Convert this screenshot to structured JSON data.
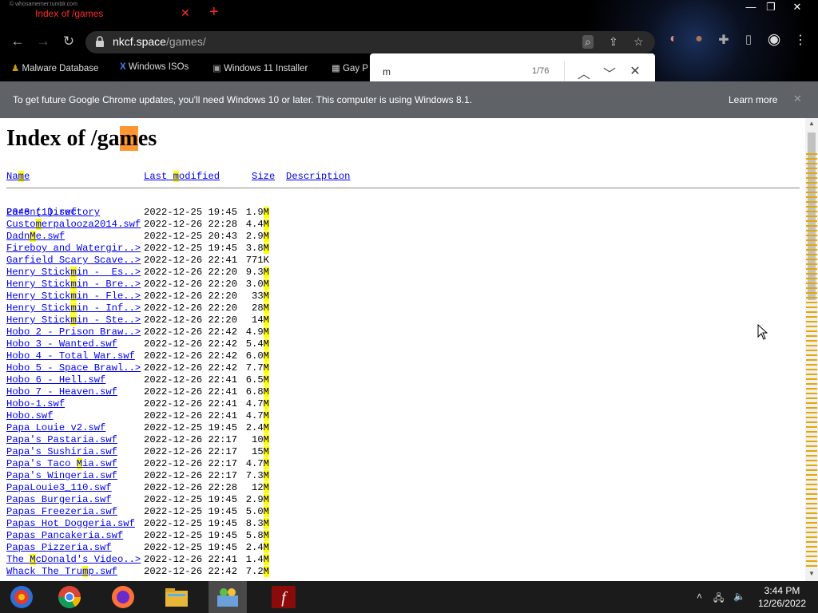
{
  "tab": {
    "title": "Index of /games",
    "tiny_label": "© whosamemer.tumblr.com"
  },
  "window": {
    "minimize": "—",
    "restore": "❐",
    "close": "✕"
  },
  "omnibox": {
    "host": "nkcf.space",
    "path": "/games/"
  },
  "bookmarks": [
    {
      "label": "Malware Database",
      "icon": "bookmark-icon"
    },
    {
      "label": "Windows ISOs",
      "icon": "x-logo-icon"
    },
    {
      "label": "Windows 11 Installer",
      "icon": "image-icon"
    },
    {
      "label": "Gay P",
      "icon": "pixel-icon"
    }
  ],
  "find": {
    "query": "m",
    "count": "1/76"
  },
  "infobar": {
    "message": "To get future Google Chrome updates, you'll need Windows 10 or later. This computer is using Windows 8.1.",
    "learn_more": "Learn more"
  },
  "page": {
    "heading_pre": "Index of /ga",
    "heading_match": "m",
    "heading_post": "es",
    "columns": {
      "name_pre": "Na",
      "name_m": "m",
      "name_post": "e",
      "modified_pre": "Last ",
      "modified_m": "m",
      "modified_post": "odified",
      "size": "Size",
      "description": "Description"
    },
    "parent": {
      "name": "Parent Directory",
      "size": "-"
    },
    "files": [
      {
        "name": "2048 (1).swf",
        "date": "2022-12-25 19:45",
        "size": "1.9M"
      },
      {
        "name": "Customerpalooza2014.swf",
        "date": "2022-12-26 22:28",
        "size": "4.4M"
      },
      {
        "name": "DadnMe.swf",
        "date": "2022-12-25 20:43",
        "size": "2.9M"
      },
      {
        "name": "Fireboy and Watergir..>",
        "date": "2022-12-25 19:45",
        "size": "3.8M"
      },
      {
        "name": "Garfield Scary Scave..>",
        "date": "2022-12-26 22:41",
        "size": "771K"
      },
      {
        "name": "Henry Stickmin -  Es..>",
        "date": "2022-12-26 22:20",
        "size": "9.3M"
      },
      {
        "name": "Henry Stickmin - Bre..>",
        "date": "2022-12-26 22:20",
        "size": "3.0M"
      },
      {
        "name": "Henry Stickmin - Fle..>",
        "date": "2022-12-26 22:20",
        "size": "33M"
      },
      {
        "name": "Henry Stickmin - Inf..>",
        "date": "2022-12-26 22:20",
        "size": "28M"
      },
      {
        "name": "Henry Stickmin - Ste..>",
        "date": "2022-12-26 22:20",
        "size": "14M"
      },
      {
        "name": "Hobo 2 - Prison Braw..>",
        "date": "2022-12-26 22:42",
        "size": "4.9M"
      },
      {
        "name": "Hobo 3 - Wanted.swf",
        "date": "2022-12-26 22:42",
        "size": "5.4M"
      },
      {
        "name": "Hobo 4 - Total War.swf",
        "date": "2022-12-26 22:42",
        "size": "6.0M"
      },
      {
        "name": "Hobo 5 - Space Brawl..>",
        "date": "2022-12-26 22:42",
        "size": "7.7M"
      },
      {
        "name": "Hobo 6 - Hell.swf",
        "date": "2022-12-26 22:41",
        "size": "6.5M"
      },
      {
        "name": "Hobo 7 - Heaven.swf",
        "date": "2022-12-26 22:41",
        "size": "6.8M"
      },
      {
        "name": "Hobo-1.swf",
        "date": "2022-12-26 22:41",
        "size": "4.7M"
      },
      {
        "name": "Hobo.swf",
        "date": "2022-12-26 22:41",
        "size": "4.7M"
      },
      {
        "name": "Papa Louie v2.swf",
        "date": "2022-12-25 19:45",
        "size": "2.4M"
      },
      {
        "name": "Papa's Pastaria.swf",
        "date": "2022-12-26 22:17",
        "size": "10M"
      },
      {
        "name": "Papa's Sushiria.swf",
        "date": "2022-12-26 22:17",
        "size": "15M"
      },
      {
        "name": "Papa's Taco Mia.swf",
        "date": "2022-12-26 22:17",
        "size": "4.7M"
      },
      {
        "name": "Papa's Wingeria.swf",
        "date": "2022-12-26 22:17",
        "size": "7.3M"
      },
      {
        "name": "PapaLouie3_110.swf",
        "date": "2022-12-26 22:28",
        "size": "12M"
      },
      {
        "name": "Papas Burgeria.swf",
        "date": "2022-12-25 19:45",
        "size": "2.9M"
      },
      {
        "name": "Papas Freezeria.swf",
        "date": "2022-12-25 19:45",
        "size": "5.0M"
      },
      {
        "name": "Papas Hot Doggeria.swf",
        "date": "2022-12-25 19:45",
        "size": "8.3M"
      },
      {
        "name": "Papas Pancakeria.swf",
        "date": "2022-12-25 19:45",
        "size": "5.8M"
      },
      {
        "name": "Papas Pizzeria.swf",
        "date": "2022-12-25 19:45",
        "size": "2.4M"
      },
      {
        "name": "The McDonald's Video..>",
        "date": "2022-12-26 22:41",
        "size": "1.4M"
      },
      {
        "name": "Whack The Trump.swf",
        "date": "2022-12-26 22:42",
        "size": "7.2M"
      }
    ]
  },
  "taskbar": {
    "apps": [
      "start-icon",
      "chrome-icon",
      "firefox-icon",
      "file-explorer-icon",
      "control-panel-icon",
      "flash-player-icon"
    ]
  },
  "clock": {
    "time": "3:44 PM",
    "date": "12/26/2022"
  },
  "colors": {
    "find_active": "#ff9632",
    "find_match": "#ffff00",
    "link": "#0000ee",
    "infobar": "#5f6368"
  }
}
